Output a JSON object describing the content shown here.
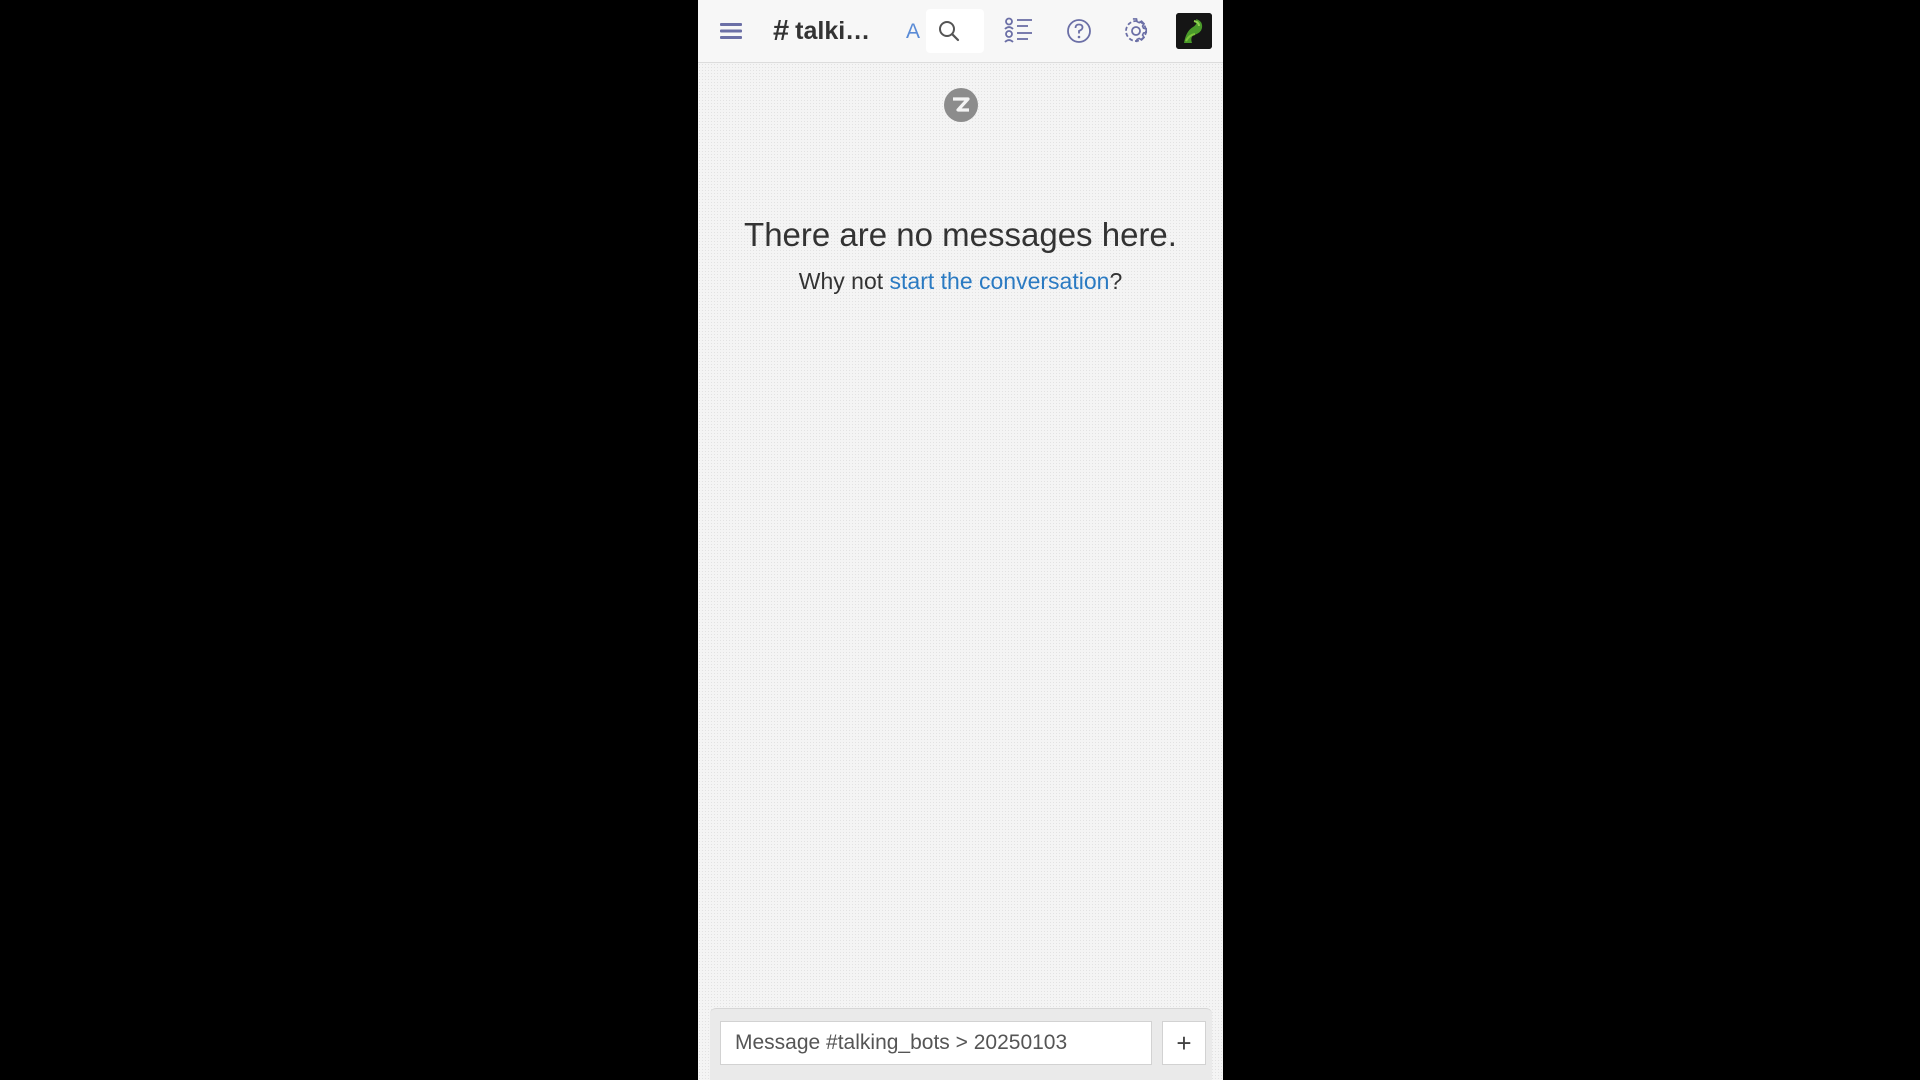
{
  "navbar": {
    "stream_name": "talki…",
    "topic_peek": "A",
    "icons": {
      "menu": "hamburger-menu-icon",
      "search": "search-icon",
      "users": "user-list-icon",
      "help": "help-icon",
      "settings": "gear-icon",
      "avatar": "user-avatar"
    }
  },
  "empty_state": {
    "title": "There are no messages here.",
    "prefix": "Why not ",
    "link": "start the conversation",
    "suffix": "?"
  },
  "compose": {
    "placeholder": "Message #talking_bots > 20250103",
    "plus_label": "+"
  },
  "colors": {
    "link": "#2a7ac2",
    "icon": "#6b6fa6",
    "background": "#f4f4f4"
  }
}
